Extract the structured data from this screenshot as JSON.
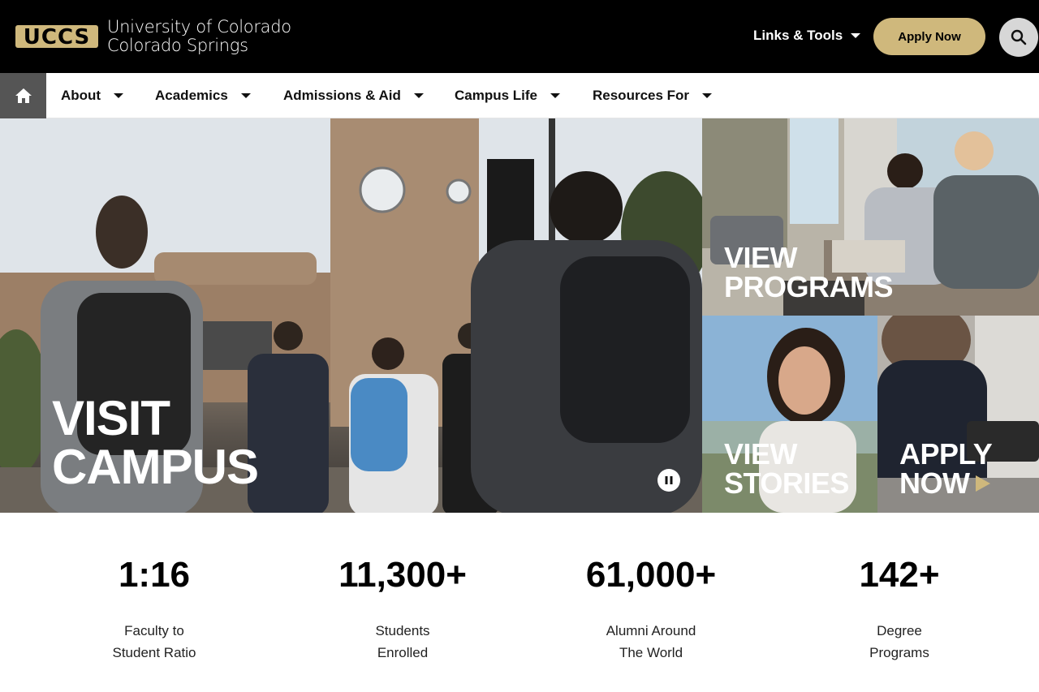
{
  "header": {
    "logo_mark": "UCCS",
    "logo_line1": "University of Colorado",
    "logo_line2": "Colorado Springs",
    "links_tools_label": "Links & Tools",
    "apply_label": "Apply Now",
    "search_icon": "search-icon",
    "brand_gold": "#cfb87c"
  },
  "nav": {
    "home_icon": "home-icon",
    "items": [
      {
        "label": "About"
      },
      {
        "label": "Academics"
      },
      {
        "label": "Admissions & Aid"
      },
      {
        "label": "Campus Life"
      },
      {
        "label": "Resources For"
      }
    ]
  },
  "hero": {
    "title_line1": "VISIT",
    "title_line2": "CAMPUS",
    "pause_icon": "pause-icon"
  },
  "tiles": {
    "programs": {
      "line1": "VIEW",
      "line2": "PROGRAMS"
    },
    "stories": {
      "line1": "VIEW",
      "line2": "STORIES"
    },
    "apply": {
      "line1": "APPLY",
      "line2": "NOW"
    }
  },
  "stats": [
    {
      "value": "1:16",
      "line1": "Faculty to",
      "line2": "Student Ratio"
    },
    {
      "value": "11,300+",
      "line1": "Students",
      "line2": "Enrolled"
    },
    {
      "value": "61,000+",
      "line1": "Alumni Around",
      "line2": "The World"
    },
    {
      "value": "142+",
      "line1": "Degree",
      "line2": "Programs"
    }
  ]
}
